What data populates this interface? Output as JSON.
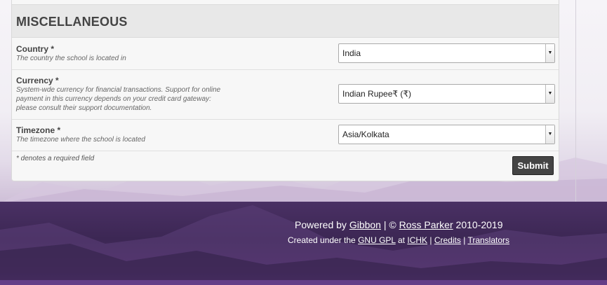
{
  "section": {
    "title": "MISCELLANEOUS"
  },
  "fields": [
    {
      "label": "Country *",
      "description": "The country the school is located in",
      "value": "India"
    },
    {
      "label": "Currency *",
      "description_lines": [
        "System-wde currency for financial transactions. Support for online",
        "payment in this currency depends on your credit card gateway:",
        "please consult their support documentation."
      ],
      "value": "Indian Rupee₹ (₹)"
    },
    {
      "label": "Timezone *",
      "description": "The timezone where the school is located",
      "value": "Asia/Kolkata"
    }
  ],
  "form": {
    "required_note": "* denotes a required field",
    "submit_label": "Submit"
  },
  "footer": {
    "powered_by": "Powered by",
    "gibbon": "Gibbon",
    "sep1": "| ©",
    "ross_parker": "Ross Parker",
    "years": "2010-2019",
    "created_under": "Created under the",
    "gnu_gpl": "GNU GPL",
    "at": "at",
    "ichk": "ICHK",
    "pipe": "|",
    "credits": "Credits",
    "translators": "Translators"
  },
  "icons": {
    "select_arrow": "chevron-down-icon"
  }
}
